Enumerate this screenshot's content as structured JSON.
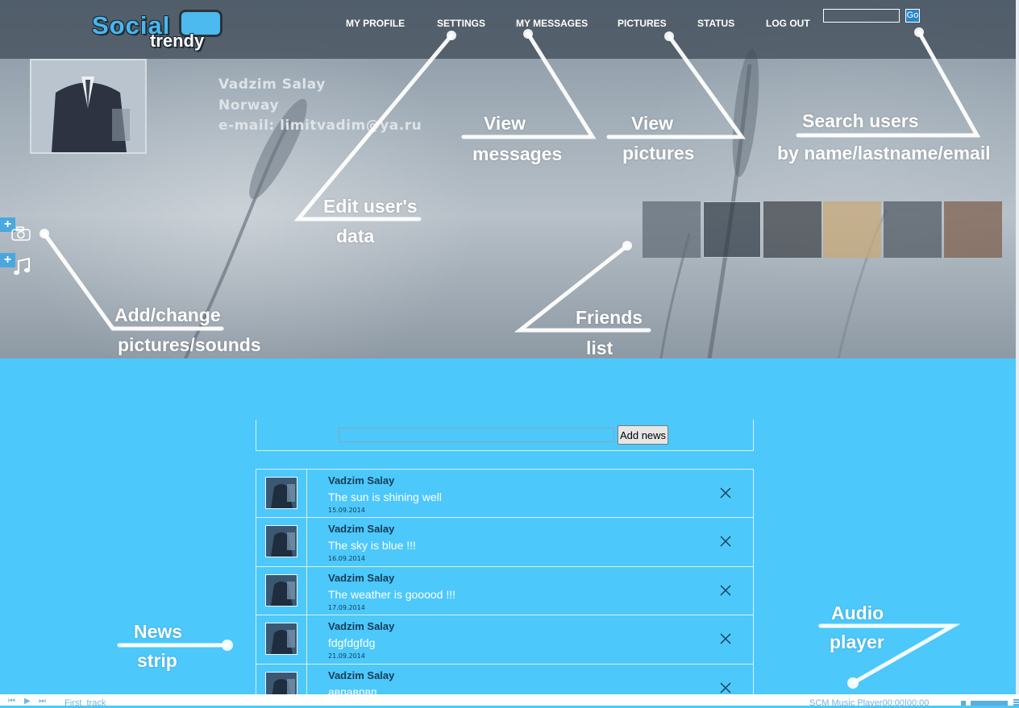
{
  "brand": {
    "logo_top": "Social",
    "logo_bottom": "trendy"
  },
  "nav": [
    {
      "label": "MY PROFILE"
    },
    {
      "label": "SETTINGS"
    },
    {
      "label": "MY MESSAGES"
    },
    {
      "label": "PICTURES"
    },
    {
      "label": "STATUS"
    },
    {
      "label": "LOG OUT"
    }
  ],
  "search": {
    "value": "",
    "button": "Go"
  },
  "profile": {
    "name": "Vadzim Salay",
    "country": "Norway",
    "email": "e-mail: limitvadim@ya.ru"
  },
  "side": {
    "add_symbol": "+",
    "camera_icon": "camera-icon",
    "music_icon": "music-note-icon"
  },
  "friends": [
    {
      "name": "friend-1",
      "color": "#5b6772"
    },
    {
      "name": "friend-2",
      "color": "#2f3a44"
    },
    {
      "name": "friend-3",
      "color": "#3a3f44"
    },
    {
      "name": "friend-4",
      "color": "#c9a673"
    },
    {
      "name": "friend-5",
      "color": "#4d5660"
    },
    {
      "name": "friend-6",
      "color": "#7a5a46"
    }
  ],
  "annotations": {
    "view_messages_1": "View",
    "view_messages_2": "messages",
    "view_pictures_1": "View",
    "view_pictures_2": "pictures",
    "search_1": "Search users",
    "search_2": "by name/lastname/email",
    "edit_1": "Edit user's",
    "edit_2": "data",
    "add_change_1": "Add/change",
    "add_change_2": "pictures/sounds",
    "friends_1": "Friends",
    "friends_2": "list",
    "news_1": "News",
    "news_2": "strip",
    "audio_1": "Audio",
    "audio_2": "player"
  },
  "composer": {
    "value": "",
    "button": "Add news"
  },
  "news": [
    {
      "author": "Vadzim Salay",
      "text": "The sun is shining well",
      "date": "15.09.2014"
    },
    {
      "author": "Vadzim Salay",
      "text": "The sky is blue !!!",
      "date": "16.09.2014"
    },
    {
      "author": "Vadzim Salay",
      "text": "The weather is gooood !!!",
      "date": "17.09.2014"
    },
    {
      "author": "Vadzim Salay",
      "text": "fdgfdgfdg",
      "date": "21.09.2014"
    },
    {
      "author": "Vadzim Salay",
      "text": "авпавпвп",
      "date": ""
    }
  ],
  "player": {
    "track": "First_track",
    "info": "SCM Music Player00:00|00:00"
  },
  "colors": {
    "accent": "#4cc8fb",
    "topbar": "#3c4854",
    "author": "#173a55"
  }
}
